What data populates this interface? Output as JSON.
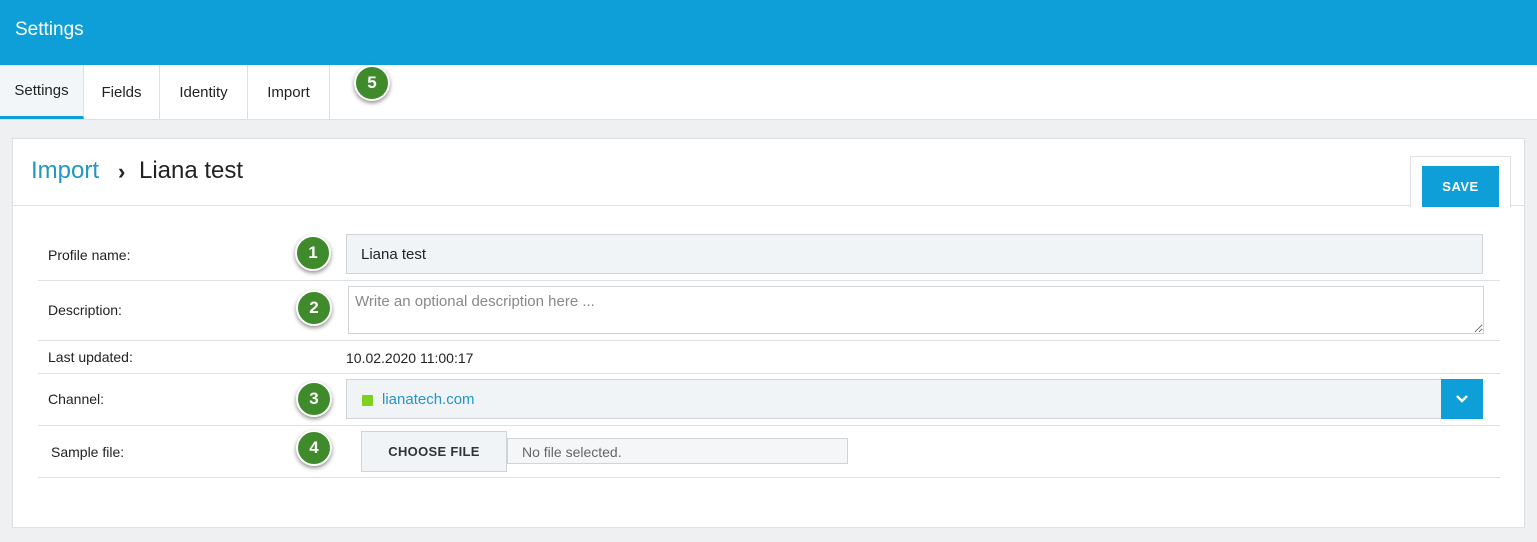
{
  "header": {
    "title": "Settings"
  },
  "tabs": [
    {
      "label": "Settings",
      "active": true
    },
    {
      "label": "Fields",
      "active": false
    },
    {
      "label": "Identity",
      "active": false
    },
    {
      "label": "Import",
      "active": false
    }
  ],
  "badges": [
    "1",
    "2",
    "3",
    "4",
    "5"
  ],
  "breadcrumb": {
    "parent": "Import",
    "separator": "›",
    "current": "Liana test"
  },
  "toolbar": {
    "save_label": "SAVE"
  },
  "form": {
    "profile_name": {
      "label": "Profile name:",
      "value": "Liana test"
    },
    "description": {
      "label": "Description:",
      "placeholder": "Write an optional description here ..."
    },
    "last_updated": {
      "label": "Last updated:",
      "value": "10.02.2020 11:00:17"
    },
    "channel": {
      "label": "Channel:",
      "value": "lianatech.com",
      "dot_color": "#7fd21c"
    },
    "sample_file": {
      "label": "Sample file:",
      "button_label": "CHOOSE FILE",
      "status": "No file selected."
    }
  },
  "colors": {
    "accent": "#0f9fd8",
    "badge": "#3f8b2c",
    "link": "#2196c9"
  }
}
